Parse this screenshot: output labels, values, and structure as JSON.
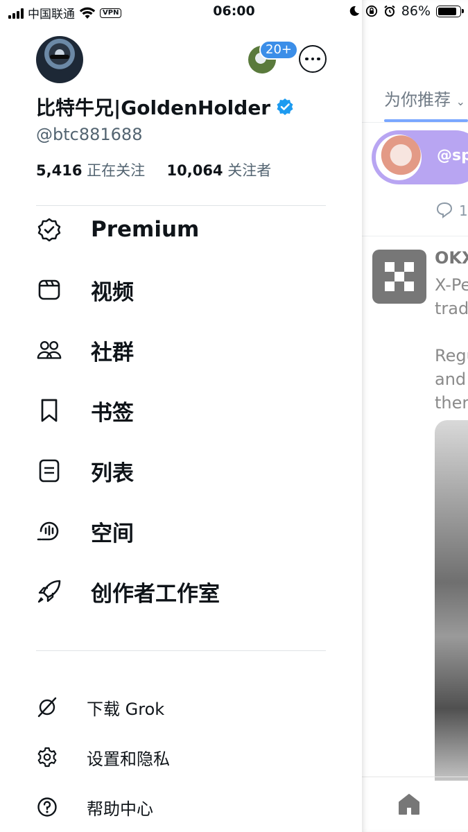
{
  "status_bar": {
    "carrier": "中国联通",
    "vpn": "VPN",
    "time": "06:00",
    "battery": "86%",
    "battery_level": 0.86
  },
  "profile": {
    "display_name": "比特牛兄|GoldenHolder",
    "handle": "@btc881688",
    "following_count": "5,416",
    "following_label": "正在关注",
    "followers_count": "10,064",
    "followers_label": "关注者",
    "account_badge": "20+"
  },
  "menu": {
    "primary": [
      {
        "label": "Premium",
        "icon": "premium-badge-icon"
      },
      {
        "label": "视频",
        "icon": "video-icon"
      },
      {
        "label": "社群",
        "icon": "communities-icon"
      },
      {
        "label": "书签",
        "icon": "bookmark-icon"
      },
      {
        "label": "列表",
        "icon": "list-icon"
      },
      {
        "label": "空间",
        "icon": "spaces-icon"
      },
      {
        "label": "创作者工作室",
        "icon": "rocket-icon"
      }
    ],
    "secondary": [
      {
        "label": "下载 Grok",
        "icon": "grok-icon"
      },
      {
        "label": "设置和隐私",
        "icon": "gear-icon"
      },
      {
        "label": "帮助中心",
        "icon": "help-icon"
      }
    ]
  },
  "feed": {
    "tab_label": "为你推荐",
    "promo_text": "@sp",
    "reply_count": "1(",
    "post_author": "OKX",
    "post_lines": [
      "X-Pe",
      "trad",
      "",
      "Regu",
      "and",
      "ther"
    ]
  },
  "colors": {
    "verified": "#1d9bf0",
    "badge": "#3b8ee8",
    "text": "#0f1419",
    "secondary_text": "#536471"
  }
}
